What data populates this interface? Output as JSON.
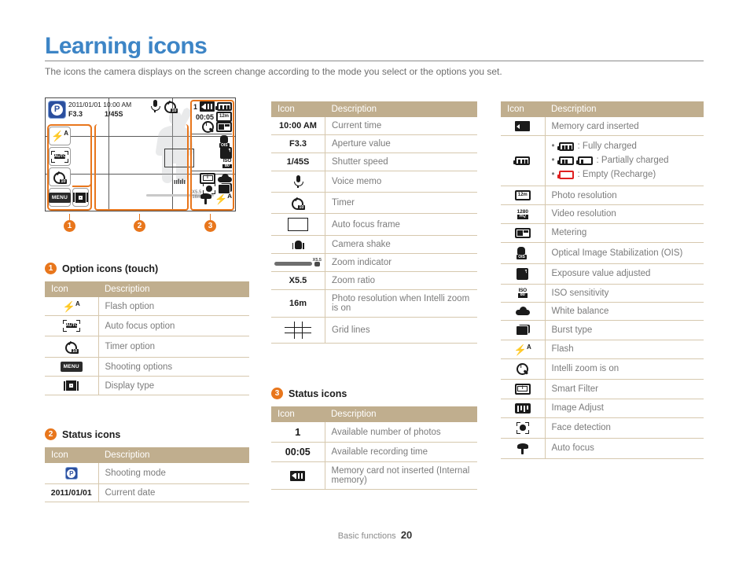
{
  "page": {
    "title": "Learning icons",
    "subtitle": "The icons the camera displays on the screen change according to the mode you select or the options you set.",
    "footer_label": "Basic functions",
    "footer_page": "20",
    "accent_color": "#e8761c",
    "title_color": "#3d85c6",
    "table_header_color": "#c0ae8e"
  },
  "camera_preview": {
    "markers": [
      "1",
      "2",
      "3"
    ],
    "mode_badge": "P",
    "date": "2011/01/01",
    "time": "10:00 AM",
    "aperture": "F3.3",
    "shutter": "1/45S",
    "mic_icon": "voice-memo-icon",
    "timer_icon": "timer-icon",
    "option_buttons": [
      {
        "name": "flash-option-icon",
        "label": "⚡"
      },
      {
        "name": "auto-focus-option-icon",
        "label": "AUTO"
      },
      {
        "name": "timer-option-icon",
        "label": "timer"
      },
      {
        "name": "menu-icon",
        "label": "MENU"
      },
      {
        "name": "display-type-icon",
        "label": "display"
      }
    ],
    "status_right": {
      "photos_remaining": "1",
      "recording_time": "00:05",
      "icons": [
        "card-icon",
        "battery-icon",
        "photo-resolution-icon",
        "video-resolution-icon",
        "intelli-zoom-icon",
        "metering-icon",
        "ois-icon",
        "exposure-icon",
        "iso-icon",
        "smart-filter-icon",
        "white-balance-icon",
        "face-detection-icon",
        "burst-icon",
        "macro-icon",
        "flash-icon"
      ]
    },
    "zoom_label": "X5.5"
  },
  "sections": {
    "option_icons": {
      "num": "1",
      "title": "Option icons (touch)",
      "headers": {
        "icon": "Icon",
        "description": "Description"
      },
      "rows": [
        {
          "icon": "flash-option-icon",
          "desc": "Flash option"
        },
        {
          "icon": "auto-focus-option-icon",
          "desc": "Auto focus option"
        },
        {
          "icon": "timer-option-icon",
          "desc": "Timer option"
        },
        {
          "icon": "menu-icon",
          "desc": "Shooting options"
        },
        {
          "icon": "display-type-icon",
          "desc": "Display type"
        }
      ]
    },
    "status_icons_left": {
      "num": "2",
      "title": "Status icons",
      "headers": {
        "icon": "Icon",
        "description": "Description"
      },
      "rows": [
        {
          "icon": "shooting-mode-icon",
          "icon_text": "P",
          "desc": "Shooting mode"
        },
        {
          "icon": "current-date-text",
          "icon_text": "2011/01/01",
          "desc": "Current date"
        }
      ]
    },
    "middle_icons": {
      "headers": {
        "icon": "Icon",
        "description": "Description"
      },
      "rows": [
        {
          "icon": "current-time-text",
          "icon_text": "10:00 AM",
          "desc": "Current time"
        },
        {
          "icon": "aperture-value-text",
          "icon_text": "F3.3",
          "desc": "Aperture value"
        },
        {
          "icon": "shutter-speed-text",
          "icon_text": "1/45S",
          "desc": "Shutter speed"
        },
        {
          "icon": "voice-memo-icon",
          "icon_text": "",
          "desc": "Voice memo"
        },
        {
          "icon": "timer-icon",
          "icon_text": "",
          "desc": "Timer"
        },
        {
          "icon": "auto-focus-frame-icon",
          "icon_text": "",
          "desc": "Auto focus frame"
        },
        {
          "icon": "camera-shake-icon",
          "icon_text": "",
          "desc": "Camera shake"
        },
        {
          "icon": "zoom-indicator-icon",
          "icon_text": "",
          "desc": "Zoom indicator"
        },
        {
          "icon": "zoom-ratio-text",
          "icon_text": "X5.5",
          "desc": "Zoom ratio"
        },
        {
          "icon": "intelli-resolution-icon",
          "icon_text": "16m",
          "desc": "Photo resolution when Intelli zoom is on"
        },
        {
          "icon": "grid-lines-icon",
          "icon_text": "",
          "desc": "Grid lines"
        }
      ]
    },
    "status_icons_middle": {
      "num": "3",
      "title": "Status icons",
      "headers": {
        "icon": "Icon",
        "description": "Description"
      },
      "rows": [
        {
          "icon": "available-photos-text",
          "icon_text": "1",
          "desc": "Available number of photos"
        },
        {
          "icon": "available-recording-time-text",
          "icon_text": "00:05",
          "desc": "Available recording time"
        },
        {
          "icon": "no-memory-card-icon",
          "icon_text": "",
          "desc": "Memory card not inserted (Internal memory)"
        }
      ]
    },
    "right_icons": {
      "headers": {
        "icon": "Icon",
        "description": "Description"
      },
      "rows": [
        {
          "icon": "memory-card-icon",
          "desc": "Memory card inserted"
        },
        {
          "icon": "battery-icon",
          "desc": "",
          "battery_list": [
            {
              "state": "full",
              "text": ": Fully charged"
            },
            {
              "state": "partial",
              "text": ": Partially charged"
            },
            {
              "state": "empty",
              "text": ": Empty (Recharge)"
            }
          ]
        },
        {
          "icon": "photo-resolution-icon",
          "icon_text": "12m",
          "desc": "Photo resolution"
        },
        {
          "icon": "video-resolution-icon",
          "icon_text": "1280",
          "icon_sub": "HQ",
          "desc": "Video resolution"
        },
        {
          "icon": "metering-icon",
          "desc": "Metering"
        },
        {
          "icon": "ois-icon",
          "icon_sub": "OIS",
          "desc": "Optical Image Stabilization (OIS)"
        },
        {
          "icon": "exposure-icon",
          "desc": "Exposure value adjusted"
        },
        {
          "icon": "iso-icon",
          "icon_text": "ISO",
          "icon_sub": "80",
          "desc": "ISO sensitivity"
        },
        {
          "icon": "white-balance-icon",
          "desc": "White balance"
        },
        {
          "icon": "burst-type-icon",
          "desc": "Burst type"
        },
        {
          "icon": "flash-icon",
          "desc": "Flash"
        },
        {
          "icon": "intelli-zoom-icon",
          "desc": "Intelli zoom is on"
        },
        {
          "icon": "smart-filter-icon",
          "desc": "Smart Filter"
        },
        {
          "icon": "image-adjust-icon",
          "desc": "Image Adjust"
        },
        {
          "icon": "face-detection-icon",
          "desc": "Face detection"
        },
        {
          "icon": "auto-focus-icon",
          "desc": "Auto focus"
        }
      ]
    }
  }
}
